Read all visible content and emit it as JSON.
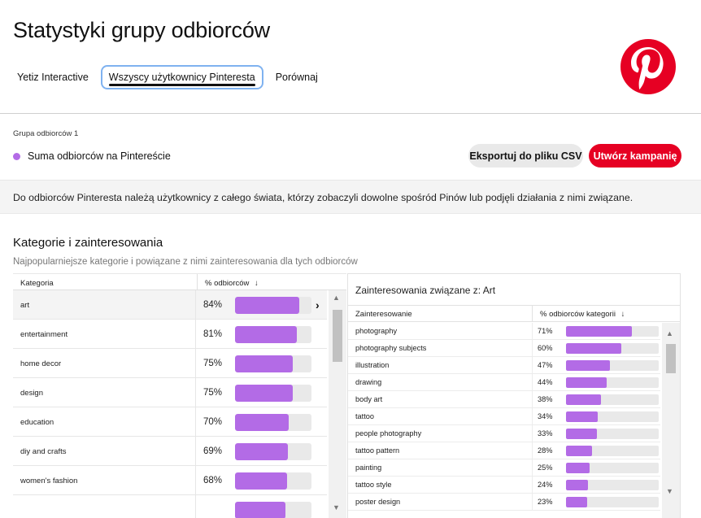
{
  "header": {
    "title": "Statystyki grupy odbiorców",
    "tabs": [
      {
        "label": "Yetiz Interactive",
        "active": false
      },
      {
        "label": "Wszyscy użytkownicy Pinteresta",
        "active": true
      },
      {
        "label": "Porównaj",
        "active": false
      }
    ],
    "logo": "pinterest-logo"
  },
  "group": {
    "label": "Grupa odbiorców 1",
    "name": "Suma odbiorców na Pintereście",
    "dot_color": "#b36be6",
    "export_label": "Eksportuj do pliku CSV",
    "create_label": "Utwórz kampanię"
  },
  "info": {
    "text": "Do odbiorców Pinteresta należą użytkownicy z całego świata, którzy zobaczyli dowolne spośród Pinów lub podjęli działania z nimi związane."
  },
  "categories_section": {
    "title": "Kategorie i zainteresowania",
    "subtitle": "Najpopularniejsze kategorie i powiązane z nimi zainteresowania dla tych odbiorców",
    "col_category": "Kategoria",
    "col_percent": "% odbiorców",
    "sort_icon": "arrow-down-icon",
    "rows": [
      {
        "name": "art",
        "pct": "84%",
        "value": 84
      },
      {
        "name": "entertainment",
        "pct": "81%",
        "value": 81
      },
      {
        "name": "home decor",
        "pct": "75%",
        "value": 75
      },
      {
        "name": "design",
        "pct": "75%",
        "value": 75
      },
      {
        "name": "education",
        "pct": "70%",
        "value": 70
      },
      {
        "name": "diy and crafts",
        "pct": "69%",
        "value": 69
      },
      {
        "name": "women's fashion",
        "pct": "68%",
        "value": 68
      },
      {
        "name": "",
        "pct": "",
        "value": 66
      }
    ]
  },
  "interests_section": {
    "title": "Zainteresowania związane z: Art",
    "col_interest": "Zainteresowanie",
    "col_percent": "% odbiorców kategorii",
    "rows": [
      {
        "name": "photography",
        "pct": "71%",
        "value": 71
      },
      {
        "name": "photography subjects",
        "pct": "60%",
        "value": 60
      },
      {
        "name": "illustration",
        "pct": "47%",
        "value": 47
      },
      {
        "name": "drawing",
        "pct": "44%",
        "value": 44
      },
      {
        "name": "body art",
        "pct": "38%",
        "value": 38
      },
      {
        "name": "tattoo",
        "pct": "34%",
        "value": 34
      },
      {
        "name": "people photography",
        "pct": "33%",
        "value": 33
      },
      {
        "name": "tattoo pattern",
        "pct": "28%",
        "value": 28
      },
      {
        "name": "painting",
        "pct": "25%",
        "value": 25
      },
      {
        "name": "tattoo style",
        "pct": "24%",
        "value": 24
      },
      {
        "name": "poster design",
        "pct": "23%",
        "value": 23
      }
    ]
  },
  "colors": {
    "accent": "#e60023",
    "bar": "#b36be6",
    "bar_track": "#e9e9e9"
  }
}
